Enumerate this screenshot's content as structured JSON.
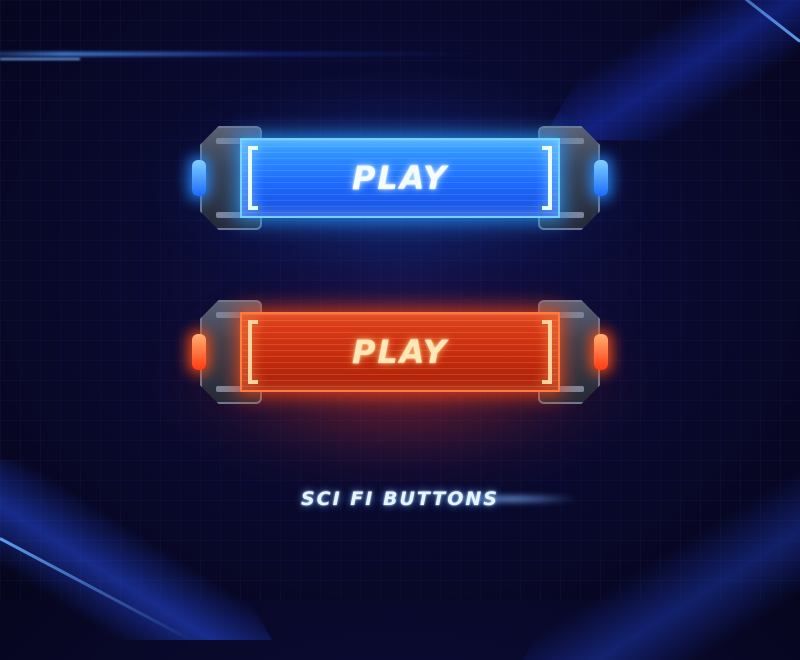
{
  "buttons": {
    "blue": {
      "label": "PLAY",
      "color": "#1e6cff"
    },
    "red": {
      "label": "PLAY",
      "color": "#c32a0c"
    }
  },
  "caption": "SCI FI BUTTONS",
  "colors": {
    "background": "#0a0a30",
    "blue_glow": "#3fa0ff",
    "red_glow": "#ff4a1a"
  }
}
